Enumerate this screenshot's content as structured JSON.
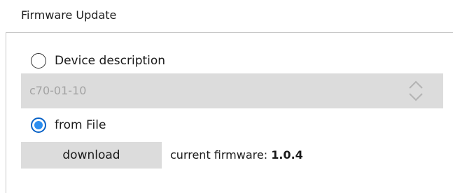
{
  "section": {
    "title": "Firmware Update"
  },
  "options": {
    "device_description": {
      "label": "Device description",
      "selected": false
    },
    "from_file": {
      "label": "from File",
      "selected": true
    }
  },
  "device_select": {
    "value": "c70-01-10",
    "enabled": false,
    "icon": "chevron-up-down-icon"
  },
  "download": {
    "label": "download"
  },
  "firmware": {
    "label": "current firmware:",
    "version": "1.0.4"
  },
  "colors": {
    "radio_accent": "#2c8ef0",
    "disabled_bg": "#dcdcdc",
    "disabled_text": "#a3a3a3"
  }
}
